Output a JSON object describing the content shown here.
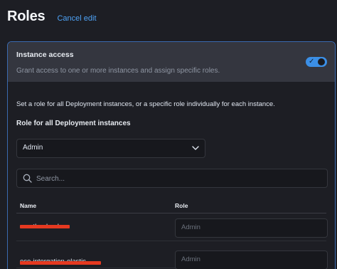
{
  "header": {
    "title": "Roles",
    "cancel_label": "Cancel edit"
  },
  "instance_access": {
    "title": "Instance access",
    "description": "Grant access to one or more instances and assign specific roles.",
    "toggle_on": true,
    "toggle_icon": "check-icon",
    "accent_color": "#3b8fe6"
  },
  "body": {
    "info_text": "Set a role for all Deployment instances, or a specific role individually for each instance.",
    "all_role_label": "Role for all Deployment instances",
    "all_role_value": "Admin"
  },
  "search": {
    "placeholder": "Search...",
    "value": ""
  },
  "table": {
    "columns": [
      "Name",
      "Role"
    ],
    "rows": [
      {
        "name": "ece-thanks-dev",
        "role_placeholder": "Admin",
        "redacted": true
      },
      {
        "name": "ece-intergation-elastic",
        "role_placeholder": "Admin",
        "redacted": true
      }
    ]
  },
  "colors": {
    "background": "#1d1e24",
    "panel_header": "#34363f",
    "panel_border": "#3a6ab0",
    "link": "#4ea2f5",
    "redaction": "#e53920"
  }
}
